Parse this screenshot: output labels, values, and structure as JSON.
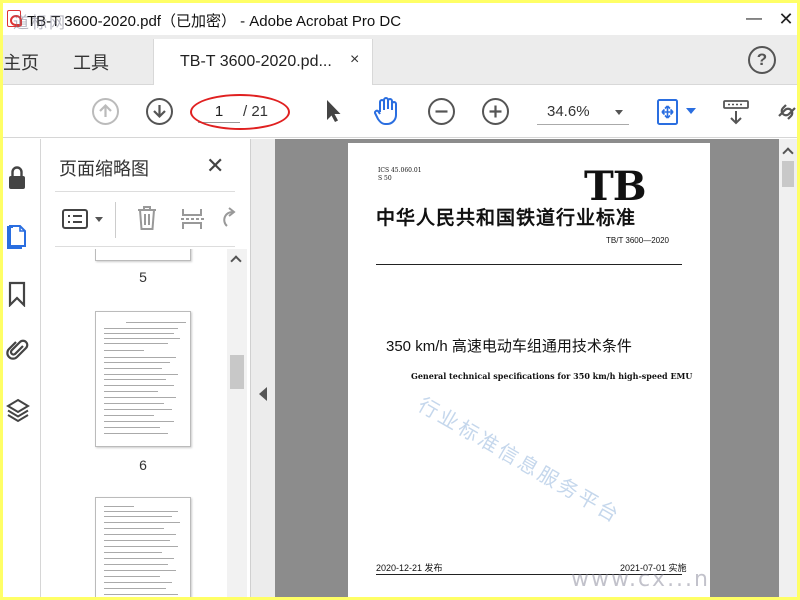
{
  "window": {
    "title": "TB-T 3600-2020.pdf（已加密） - Adobe Acrobat Pro DC",
    "minimize": "—",
    "close": "✕",
    "watermark": "道标网"
  },
  "tabs": {
    "home": "主页",
    "tools": "工具",
    "document": "TB-T  3600-2020.pd...",
    "close": "×",
    "help": "?"
  },
  "toolbar": {
    "current_page": "1",
    "total_pages": "/ 21",
    "zoom": "34.6%"
  },
  "thumbnails": {
    "title": "页面缩略图",
    "close": "✕",
    "labels": [
      "5",
      "6"
    ]
  },
  "document": {
    "ics": "ICS 45.060.01",
    "ccs": "S 50",
    "logo": "TB",
    "standard_title": "中华人民共和国铁道行业标准",
    "standard_number": "TB/T 3600—2020",
    "title_zh": "350 km/h 高速电动车组通用技术条件",
    "title_en": "General technical specifications for 350 km/h high-speed EMU",
    "issue_date": "2020-12-21 发布",
    "implementation_date": "2021-07-01 实施",
    "diagonal_watermark": "行业标准信息服务平台",
    "site_watermark": "www.cx...n"
  },
  "colors": {
    "frame": "#ffff66",
    "annotation": "#e02020",
    "accent": "#2a6ee0"
  }
}
